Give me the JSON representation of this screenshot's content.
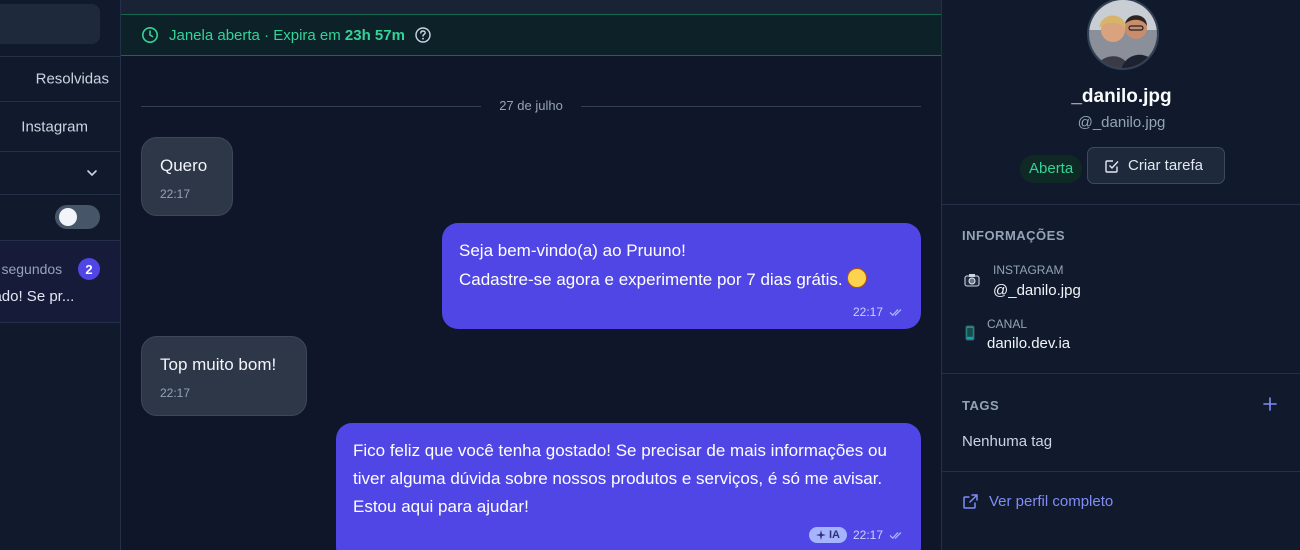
{
  "left_panel": {
    "filter_resolved": "Resolvidas",
    "filter_channel": "Instagram",
    "conversation": {
      "time": "há segundos",
      "unread": "2",
      "preview": "Fico feliz que você tenha gostado! Se pr..."
    }
  },
  "chat": {
    "banner": {
      "prefix": "Janela aberta · Expira em ",
      "remaining": "23h 57m"
    },
    "date_separator": "27 de julho",
    "messages": [
      {
        "direction": "in",
        "text": "Quero",
        "time": "22:17"
      },
      {
        "direction": "out",
        "line1": "Seja bem-vindo(a) ao Pruuno!",
        "line2": "Cadastre-se agora e experimente por 7 dias grátis.",
        "time": "22:17"
      },
      {
        "direction": "in",
        "text": "Top muito bom!",
        "time": "22:17"
      },
      {
        "direction": "out",
        "text": "Fico feliz que você tenha gostado! Se precisar de mais informações ou tiver alguma dúvida sobre nossos produtos e serviços, é só me avisar. Estou aqui para ajudar!",
        "badge": "IA",
        "time": "22:17"
      }
    ]
  },
  "profile": {
    "name": "_danilo.jpg",
    "handle": "@_danilo.jpg",
    "status": "Aberta",
    "create_task_label": "Criar tarefa",
    "info_title": "INFORMAÇÕES",
    "instagram_label": "INSTAGRAM",
    "instagram_value": "@_danilo.jpg",
    "channel_label": "CANAL",
    "channel_value": "danilo.dev.ia",
    "tags_title": "TAGS",
    "no_tags": "Nenhuma tag",
    "view_profile": "Ver perfil completo"
  },
  "colors": {
    "accent": "#4f46e5",
    "success": "#34d399",
    "background": "#0f1629"
  }
}
